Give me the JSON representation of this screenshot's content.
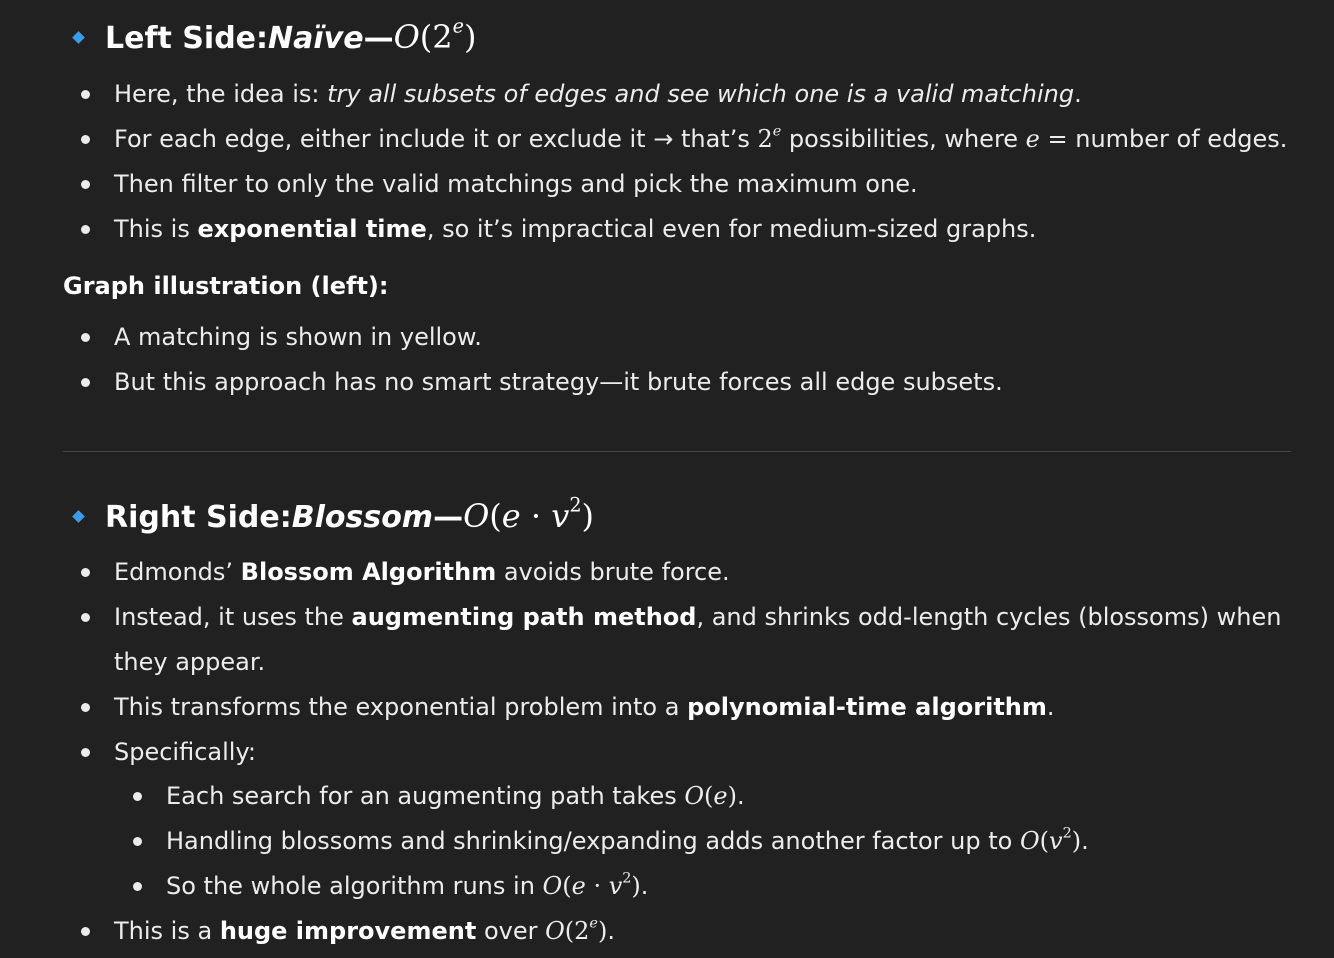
{
  "left_section": {
    "heading_prefix": "Left Side: ",
    "heading_name": "Naïve",
    "heading_dash": " — ",
    "heading_complexity": "O(2^e)",
    "bullets": [
      {
        "pre": "Here, the idea is: ",
        "italic": "try all subsets of edges and see which one is a valid matching",
        "post": "."
      },
      {
        "pre": "For each edge, either include it or exclude it → that’s ",
        "math": "2^e",
        "mid": " possibilities, where ",
        "var": "e",
        "post": " = number of edges."
      },
      {
        "text": "Then filter to only the valid matchings and pick the maximum one."
      },
      {
        "pre": "This is ",
        "bold": "exponential time",
        "post": ", so it’s impractical even for medium-sized graphs."
      }
    ]
  },
  "graph_illustration": {
    "title": "Graph illustration (left):",
    "bullets": [
      "A matching is shown in yellow.",
      "But this approach has no smart strategy—it brute forces all edge subsets."
    ]
  },
  "right_section": {
    "heading_prefix": "Right Side: ",
    "heading_name": "Blossom",
    "heading_dash": " — ",
    "heading_complexity": "O(e · v^2)",
    "bullets": [
      {
        "pre": "Edmonds’ ",
        "bold": "Blossom Algorithm",
        "post": " avoids brute force."
      },
      {
        "pre": "Instead, it uses the ",
        "bold": "augmenting path method",
        "post": ", and shrinks odd-length cycles (blossoms) when",
        "cont": "they appear."
      },
      {
        "pre": "This transforms the exponential problem into a ",
        "bold": "polynomial-time algorithm",
        "post": "."
      },
      {
        "text": "Specifically:"
      },
      {
        "pre": "This is a ",
        "bold": "huge improvement",
        "post": " over ",
        "math": "O(2^e)",
        "end": "."
      }
    ],
    "sub_bullets": [
      {
        "pre": "Each search for an augmenting path takes ",
        "math": "O(e)",
        "post": "."
      },
      {
        "pre": "Handling blossoms and shrinking/expanding adds another factor up to ",
        "math": "O(v^2)",
        "post": "."
      },
      {
        "pre": "So the whole algorithm runs in ",
        "math": "O(e · v^2)",
        "post": "."
      }
    ]
  }
}
